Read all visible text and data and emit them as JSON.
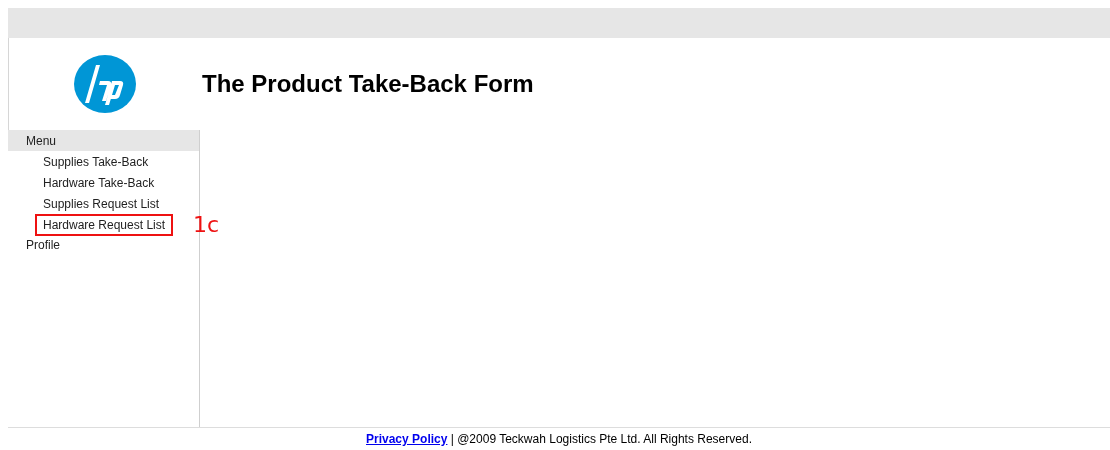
{
  "header": {
    "title": "The Product Take-Back Form"
  },
  "sidebar": {
    "heading": "Menu",
    "items": [
      {
        "label": "Supplies Take-Back",
        "annotated": false
      },
      {
        "label": "Hardware Take-Back",
        "annotated": false
      },
      {
        "label": "Supplies Request List",
        "annotated": false
      },
      {
        "label": "Hardware Request List",
        "annotated": true,
        "annotation": "1c"
      }
    ],
    "footer_item": "Profile"
  },
  "footer": {
    "link": "Privacy Policy",
    "text": " | @2009 Teckwah Logistics Pte Ltd. All Rights Reserved."
  }
}
